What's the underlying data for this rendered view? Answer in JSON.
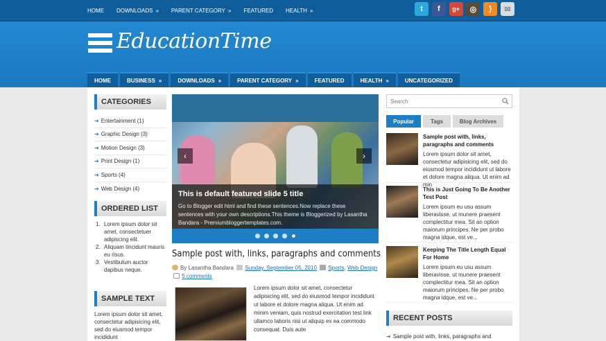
{
  "topnav": {
    "items": [
      {
        "label": "HOME",
        "caret": ""
      },
      {
        "label": "DOWNLOADS",
        "caret": "»"
      },
      {
        "label": "PARENT CATEGORY",
        "caret": "»"
      },
      {
        "label": "FEATURED",
        "caret": ""
      },
      {
        "label": "HEALTH",
        "caret": "»"
      }
    ],
    "social": [
      {
        "name": "twitter-icon",
        "glyph": "t",
        "color": "#2aa9e0"
      },
      {
        "name": "facebook-icon",
        "glyph": "f",
        "color": "#3b5998"
      },
      {
        "name": "google-plus-icon",
        "glyph": "g+",
        "color": "#d34836"
      },
      {
        "name": "instagram-icon",
        "glyph": "◎",
        "color": "#5a4a3a"
      },
      {
        "name": "rss-icon",
        "glyph": ")",
        "color": "#f08a24"
      },
      {
        "name": "email-icon",
        "glyph": "✉",
        "color": "#d8dde2"
      }
    ]
  },
  "header": {
    "site_title": "EducationTime"
  },
  "mainnav": {
    "items": [
      {
        "label": "HOME",
        "caret": ""
      },
      {
        "label": "BUSINESS",
        "caret": "»"
      },
      {
        "label": "DOWNLOADS",
        "caret": "»"
      },
      {
        "label": "PARENT CATEGORY",
        "caret": "»"
      },
      {
        "label": "FEATURED",
        "caret": ""
      },
      {
        "label": "HEALTH",
        "caret": "»"
      },
      {
        "label": "UNCATEGORIZED",
        "caret": ""
      }
    ]
  },
  "left": {
    "categories_title": "CATEGORIES",
    "categories": [
      "Entertainment (1)",
      "Graphic Design (3)",
      "Motion Design (3)",
      "Print Design (1)",
      "Sports (4)",
      "Web Design (4)"
    ],
    "ordered_list_title": "ORDERED LIST",
    "ordered_list": [
      {
        "num": "1.",
        "text": "Lorem ipsum dolor sit amet, consectetuer adipiscing elit."
      },
      {
        "num": "2.",
        "text": "Aliquam tincidunt mauris eu risus."
      },
      {
        "num": "3.",
        "text": "Vestibulum auctor dapibus neque."
      }
    ],
    "sample_text_title": "SAMPLE TEXT",
    "sample_text": "Lorem ipsum dolor sit amet, consectetur adipisicing elit, sed do eiusmod tempor incididunt"
  },
  "slider": {
    "title": "This is default featured slide 5 title",
    "description": "Go to Blogger edit html and find these sentences.Now replace these sentences with your own descriptions.This theme is Bloggerized by Lasantha Bandara - Premiumbloggertemplates.com.",
    "dots": 5,
    "active_dot": 4,
    "prev": "‹",
    "next": "›"
  },
  "post": {
    "title": "Sample post with, links, paragraphs and comments",
    "by": "By Lasantha Bandara",
    "date": "Sunday, September 05, 2010",
    "cat1": "Sports",
    "comma": ",",
    "cat2": "Web Design",
    "comments": "5 comments",
    "body": "Lorem ipsum dolor sit amet, consectetur adipisicing elit, sed do eiusmod tempor incididunt ut labore et dolore magna aliqua. Ut enim ad minim veniam, quis nostrud exercitation test link ullamco laboris nisi ut aliquip ex ea commodo consequat. Duis aute"
  },
  "right": {
    "search_placeholder": "Search",
    "tabs": [
      "Popular",
      "Tags",
      "Blog Archives"
    ],
    "popular": [
      {
        "title": "Sample post with, links, paragraphs and comments",
        "body": "Lorem ipsum dolor sit amet, consectetur adipisicing elit, sed do eiusmod tempor incididunt ut labore et dolore magna aliqua. Ut enim ad min"
      },
      {
        "title": "This is Just Going To Be Another Test Post",
        "body": "Lorem ipsum eu usu assum liberavisse, ut munere praesent complectitur mea. Sit an option maiorum principes. Ne per probo magna idque, est ve..."
      },
      {
        "title": "Keeping The Title Length Equal For Home",
        "body": "Lorem ipsum eu usu assum liberavisse, ut munere praesent complectitur mea. Sit an option maiorum principes. Ne per probo magna idque, est ve..."
      }
    ],
    "recent_title": "RECENT POSTS",
    "recent_first": "Sample post with, links, paragraphs and"
  },
  "colors": {
    "brand_blue": "#1e7fc4",
    "dark_blue": "#0f5d9b"
  }
}
